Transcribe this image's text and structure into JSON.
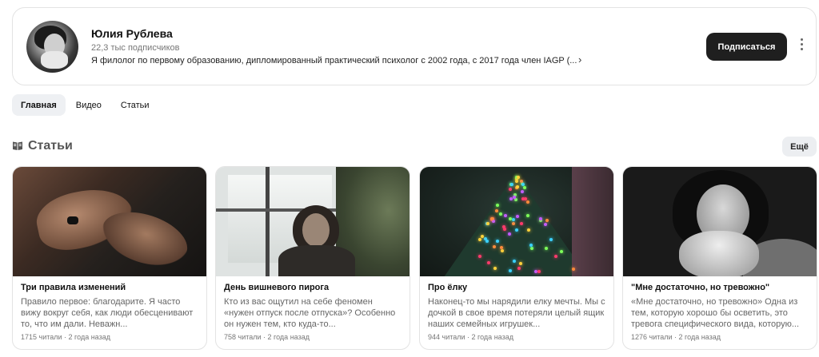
{
  "profile": {
    "name": "Юлия Рублева",
    "subscribers": "22,3 тыс подписчиков",
    "bio": "Я филолог по первому образованию, дипломированный практический психолог с 2002 года, с 2017 года член IAGP (...",
    "bio_chevron": "›",
    "subscribe_label": "Подписаться"
  },
  "tabs": [
    {
      "label": "Главная",
      "active": true
    },
    {
      "label": "Видео",
      "active": false
    },
    {
      "label": "Статьи",
      "active": false
    }
  ],
  "section": {
    "title": "Статьи",
    "more_label": "Ещё"
  },
  "articles": [
    {
      "title": "Три правила изменений",
      "text": "Правило первое: благодарите. Я часто вижу вокруг себя, как люди обесценивают то, что им дали. Неважн...",
      "meta": "1715 читали · 2 года назад"
    },
    {
      "title": "День вишневого пирога",
      "text": "Кто из вас ощутил на себе феномен «нужен отпуск после отпуска»? Особенно он нужен тем, кто куда-то...",
      "meta": "758 читали · 2 года назад"
    },
    {
      "title": "Про ёлку",
      "text": "Наконец-то мы нарядили елку мечты. Мы с дочкой в свое время потеряли целый ящик наших семейных игрушек...",
      "meta": "944 читали · 2 года назад"
    },
    {
      "title": "\"Мне достаточно, но тревожно\"",
      "text": "«Мне достаточно, но тревожно» Одна из тем, которую хорошо бы осветить, это тревога специфического вида, которую...",
      "meta": "1276 читали · 2 года назад"
    }
  ],
  "icons": {
    "more": "vertical-dots-icon",
    "section": "article-icon"
  },
  "colors": {
    "subscribe_bg": "#1f1f1f",
    "active_tab_bg": "#eef0f3"
  }
}
